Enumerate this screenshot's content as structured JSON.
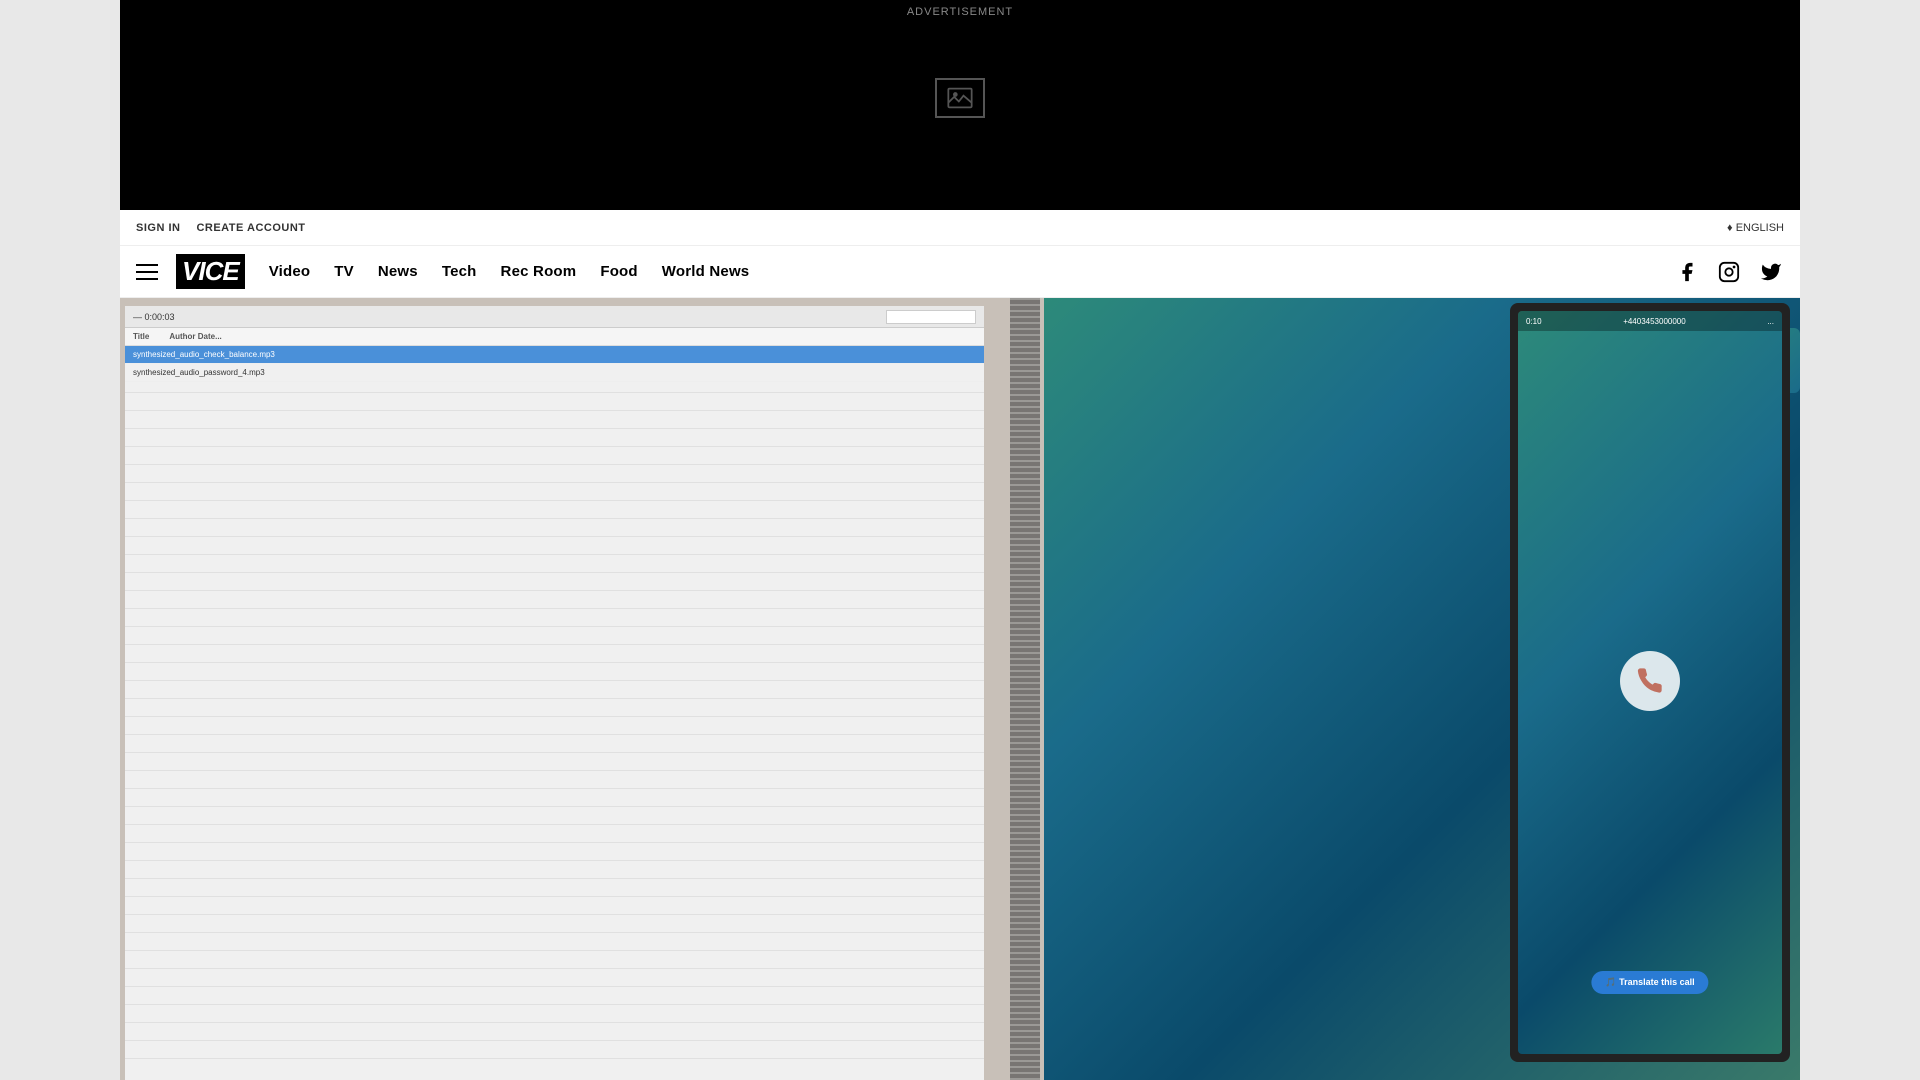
{
  "advertisement": {
    "label": "ADVERTISEMENT"
  },
  "topBar": {
    "signIn": "SIGN IN",
    "createAccount": "CREATE ACCOUNT",
    "language": "♦ ENGLISH"
  },
  "nav": {
    "logo": "VICE",
    "links": [
      {
        "id": "video",
        "label": "Video"
      },
      {
        "id": "tv",
        "label": "TV"
      },
      {
        "id": "news",
        "label": "News"
      },
      {
        "id": "tech",
        "label": "Tech"
      },
      {
        "id": "rec-room",
        "label": "Rec Room"
      },
      {
        "id": "food",
        "label": "Food"
      },
      {
        "id": "world-news",
        "label": "World News"
      }
    ],
    "social": {
      "facebook": "Facebook",
      "instagram": "Instagram",
      "twitter": "Twitter"
    }
  },
  "content": {
    "laptop": {
      "time": "— 0:00:03",
      "tableHeaders": [
        "Title",
        "Author Date...",
        "..."
      ],
      "rows": [
        {
          "text": "synthesized_audio_check_balance.mp3",
          "selected": true
        },
        {
          "text": "synthesized_audio_password_4.mp3",
          "selected": false
        }
      ]
    },
    "phone": {
      "number": "+4403453000000",
      "callTime": "0:10",
      "translateButton": "🎵 Translate this call"
    }
  }
}
